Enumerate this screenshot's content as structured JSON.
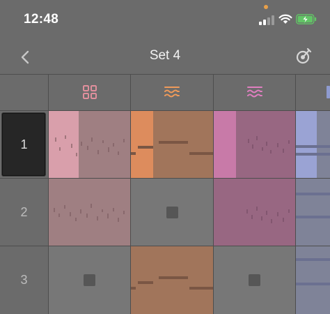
{
  "status_bar": {
    "time": "12:48"
  },
  "nav": {
    "title": "Set 4"
  },
  "tracks": [
    {
      "icon": "grid-icon",
      "color": "#d4848f"
    },
    {
      "icon": "waves-icon",
      "color": "#e8945a"
    },
    {
      "icon": "waves-icon",
      "color": "#d97ab8"
    },
    {
      "icon": "track-icon",
      "color": "#9aa7dd"
    }
  ],
  "scenes": [
    {
      "label": "1"
    },
    {
      "label": "2"
    },
    {
      "label": "3"
    }
  ],
  "colors": {
    "background": "#6b6b6b",
    "clip_pink_body": "#9f7f82",
    "clip_pink_head": "#d99fab",
    "clip_orange_body": "#a1755b",
    "clip_orange_head": "#dd8c5d",
    "clip_magenta_body": "#986782",
    "clip_magenta_head": "#c87aa8",
    "clip_blue_body": "#7f8398",
    "clip_blue_head": "#9aa3d4"
  }
}
